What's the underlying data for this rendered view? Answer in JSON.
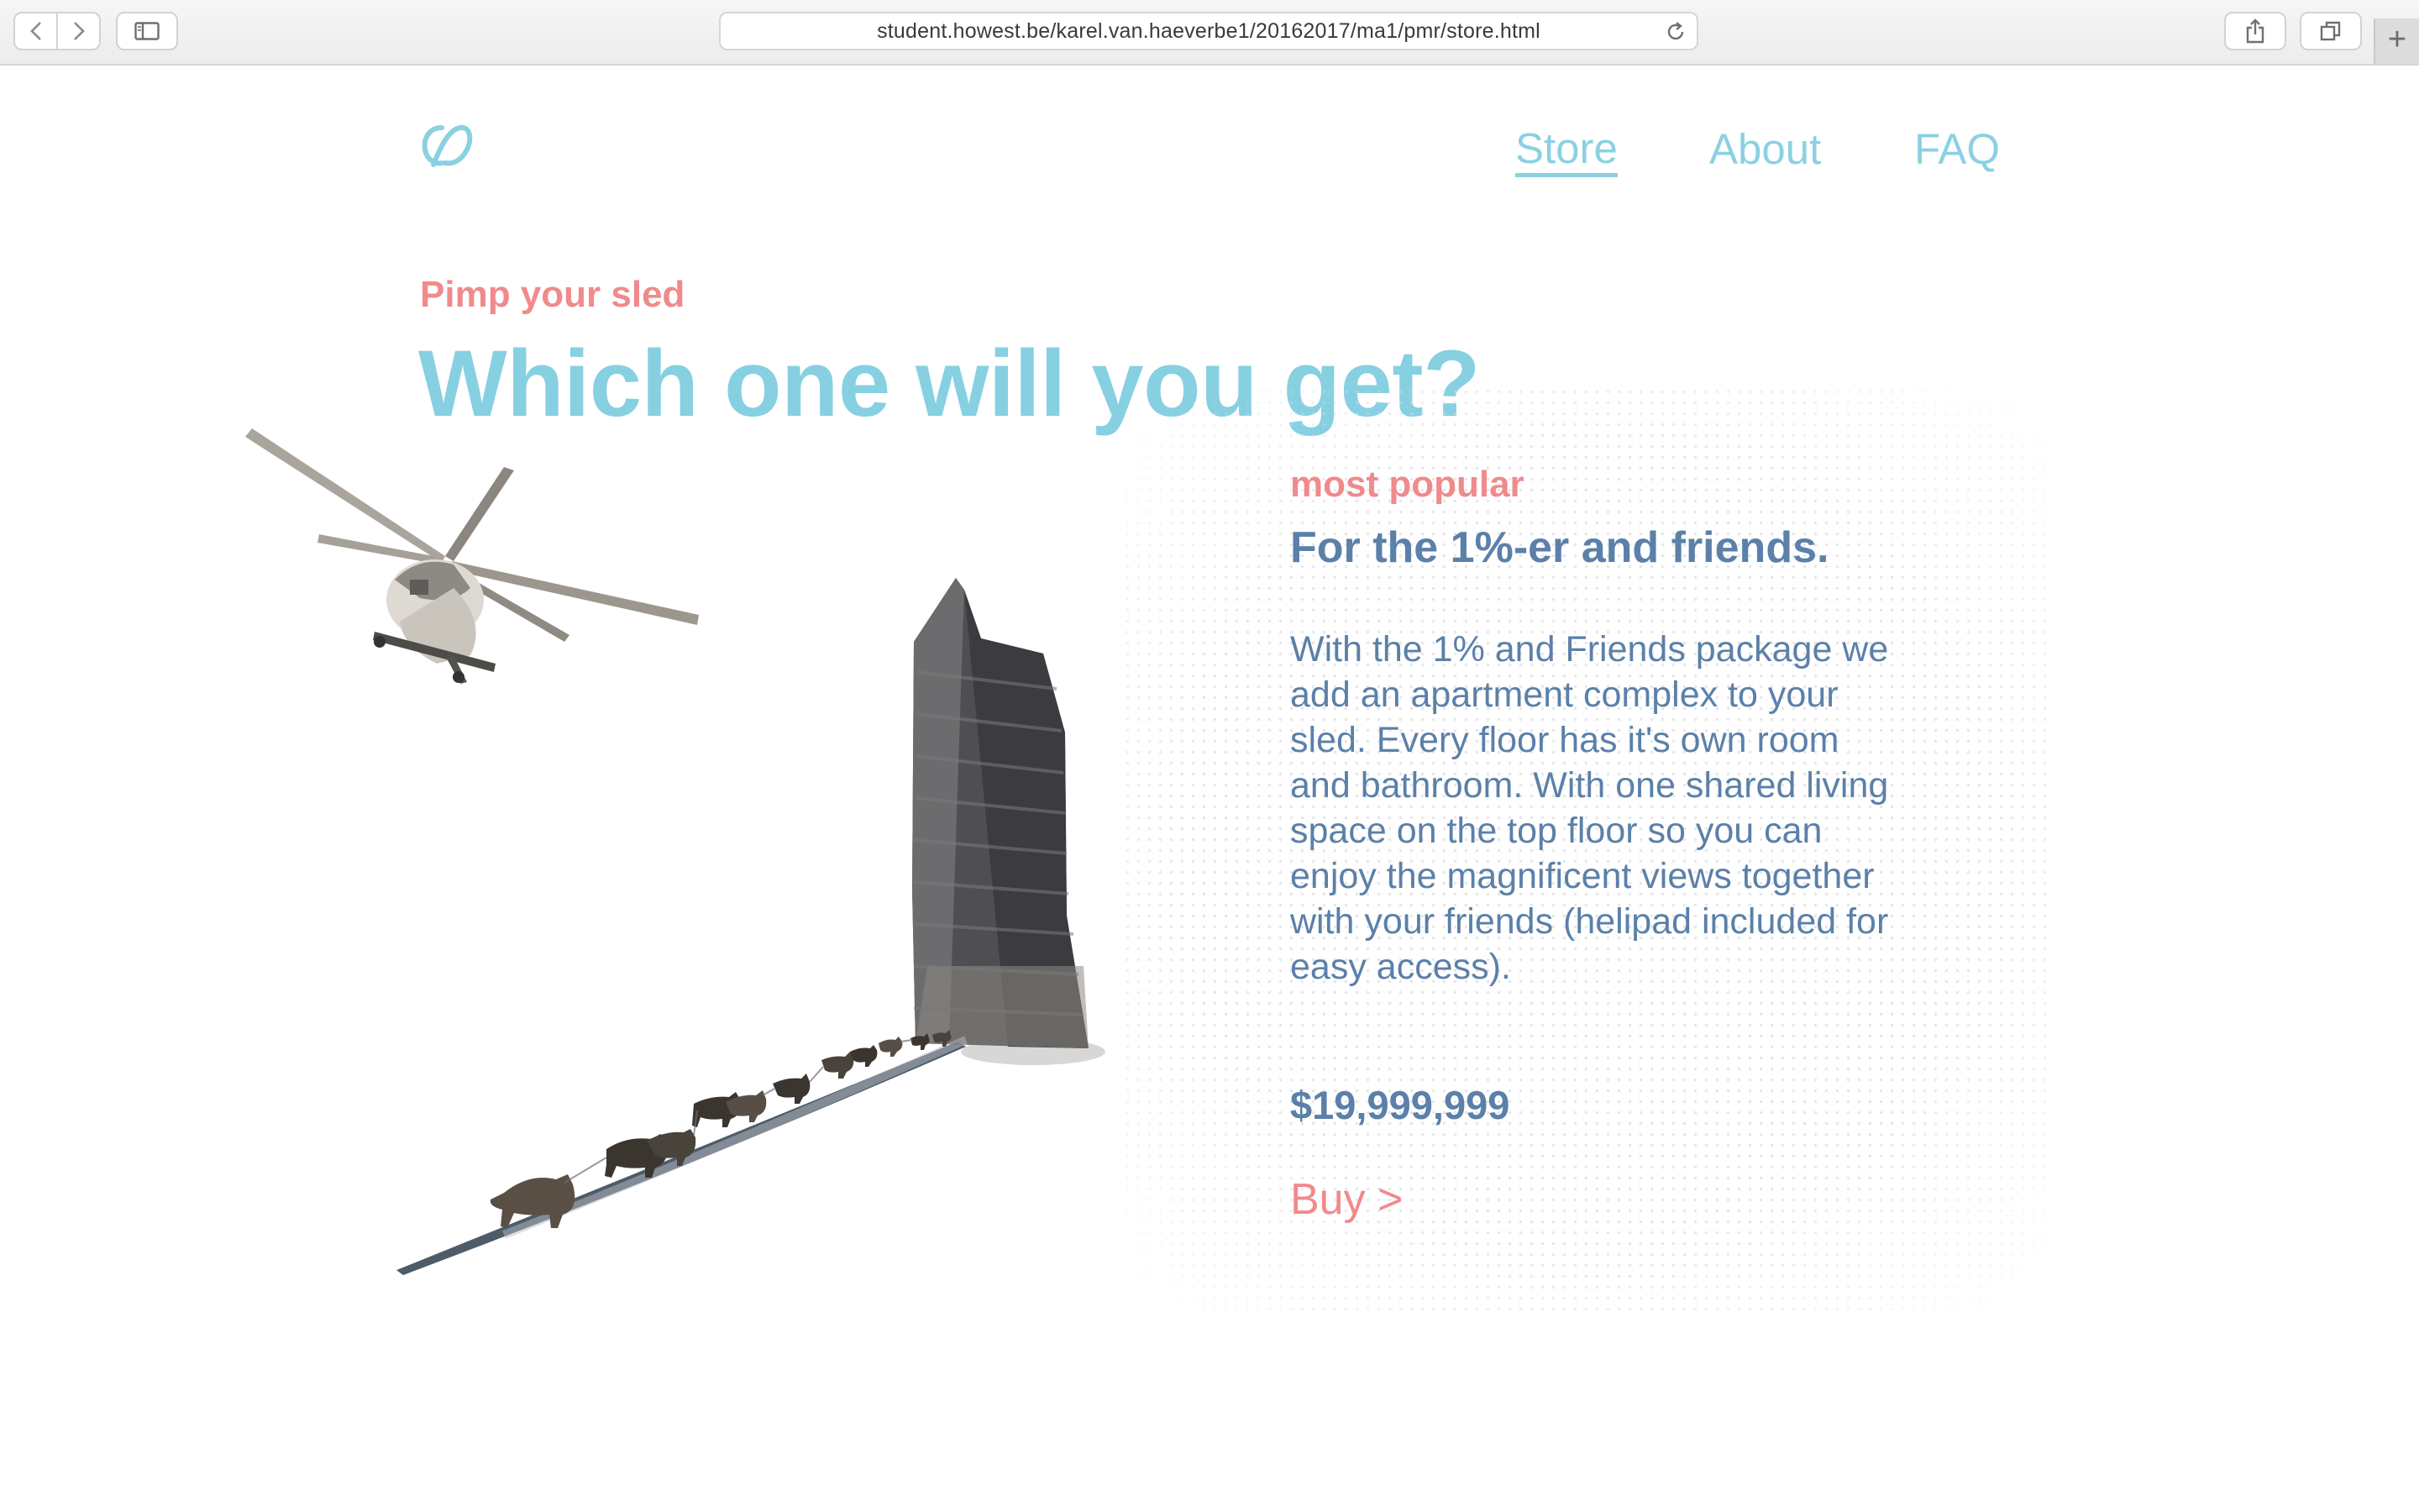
{
  "browser": {
    "url": "student.howest.be/karel.van.haeverbe1/20162017/ma1/pmr/store.html",
    "new_tab_label": "+"
  },
  "nav": {
    "items": [
      {
        "label": "Store",
        "active": true
      },
      {
        "label": "About",
        "active": false
      },
      {
        "label": "FAQ",
        "active": false
      }
    ]
  },
  "hero": {
    "kicker": "Pimp your sled",
    "headline": "Which one will you get?"
  },
  "offer": {
    "badge": "most popular",
    "title": "For the 1%-er and friends.",
    "description": "With the 1% and Friends package we add an apartment complex to your sled. Every floor has it's own room and bathroom. With one shared living space on the top floor so you can enjoy the magnificent views together with your friends (helipad included for easy access).",
    "price": "$19,999,999",
    "buy_label": "Buy >"
  },
  "colors": {
    "accent_blue": "#86d0e2",
    "accent_pink": "#f08a8c",
    "text_blue": "#5b80a9"
  },
  "icons": [
    "back-icon",
    "forward-icon",
    "sidebar-icon",
    "reload-icon",
    "share-icon",
    "tabs-icon",
    "logo-icon"
  ]
}
